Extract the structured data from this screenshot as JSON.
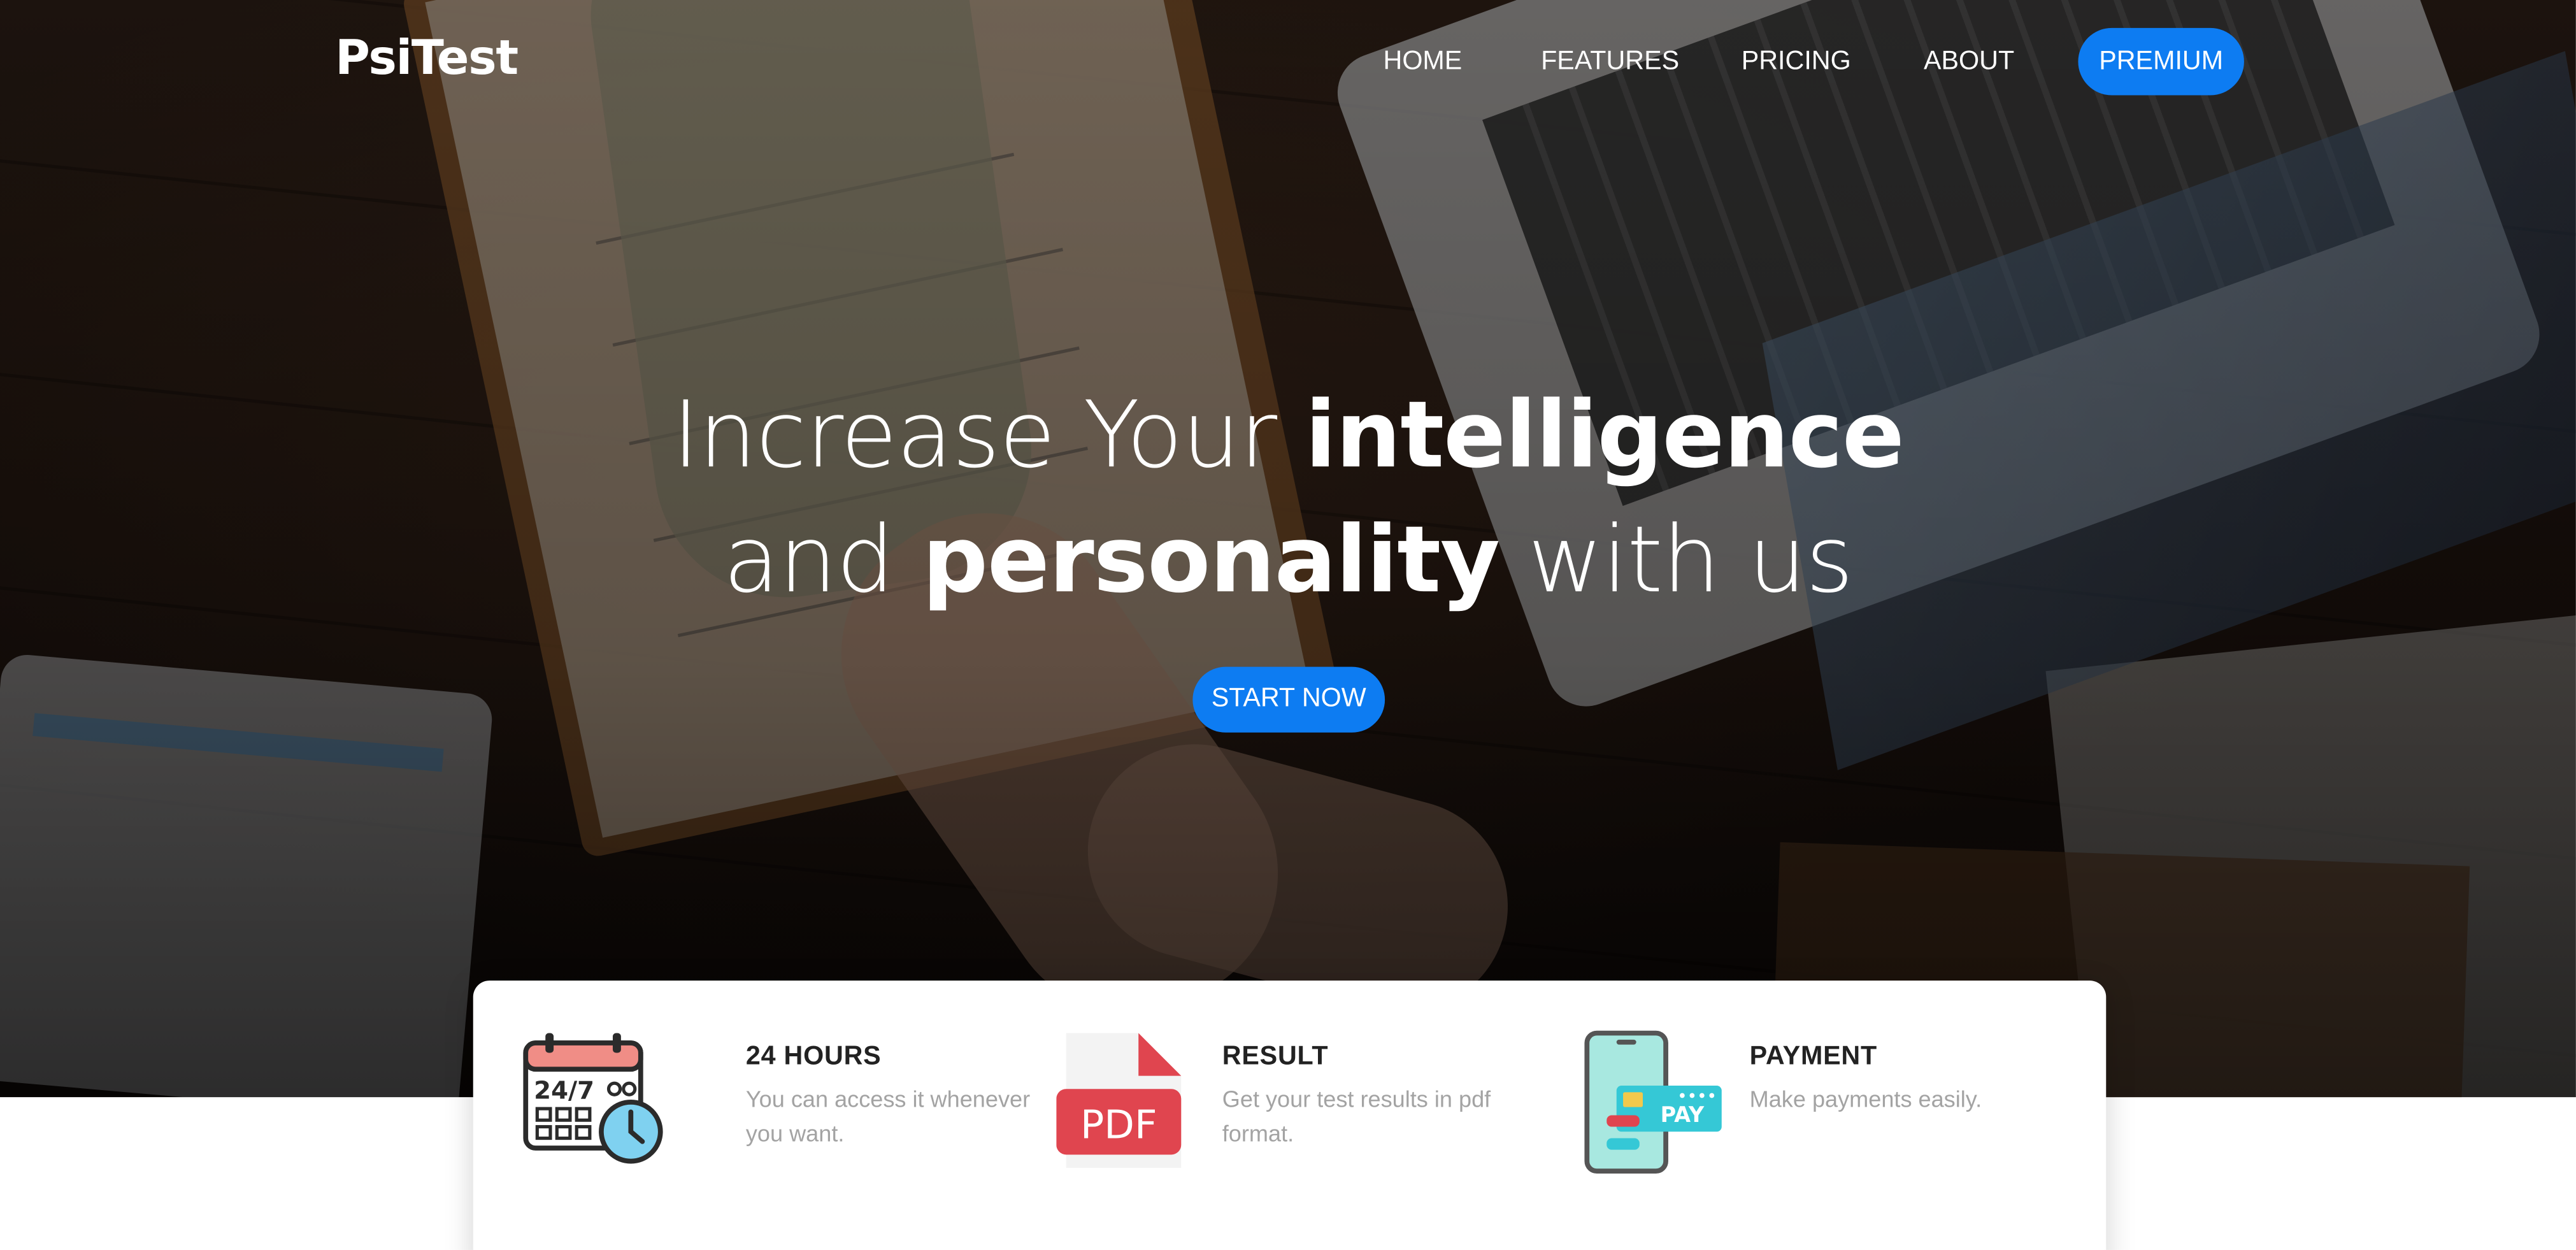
{
  "nav": {
    "logo": "PsiTest",
    "links": [
      "HOME",
      "FEATURES",
      "PRICING",
      "ABOUT"
    ],
    "premium_label": "PREMIUM"
  },
  "hero": {
    "line1_regular": "Increase Your ",
    "line1_bold": "intelligence",
    "line2_regular_start": "and ",
    "line2_bold": "personality",
    "line2_regular_end": " with us",
    "cta_label": "START NOW"
  },
  "features": [
    {
      "title": "24 HOURS",
      "desc": "You can access it whenever you want.",
      "icon": "calendar-clock-icon",
      "icon_text": "24/7"
    },
    {
      "title": "RESULT",
      "desc": "Get your test results in pdf format.",
      "icon": "pdf-file-icon",
      "icon_text": "PDF"
    },
    {
      "title": "PAYMENT",
      "desc": "Make payments easily.",
      "icon": "mobile-pay-icon",
      "icon_text": "PAY"
    }
  ],
  "colors": {
    "accent": "#0d7cf2",
    "pdf_red": "#e0454f",
    "pay_teal": "#35c8d6"
  }
}
